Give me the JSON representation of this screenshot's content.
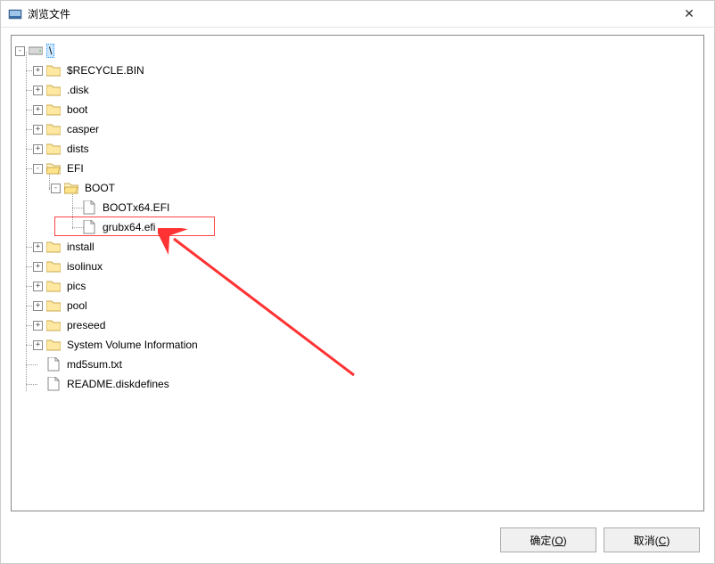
{
  "window": {
    "title": "浏览文件"
  },
  "tree": {
    "root": "\\",
    "items": [
      {
        "label": "$RECYCLE.BIN",
        "type": "folder",
        "expander": "+"
      },
      {
        "label": ".disk",
        "type": "folder",
        "expander": "+"
      },
      {
        "label": "boot",
        "type": "folder",
        "expander": "+"
      },
      {
        "label": "casper",
        "type": "folder",
        "expander": "+"
      },
      {
        "label": "dists",
        "type": "folder",
        "expander": "+"
      },
      {
        "label": "EFI",
        "type": "folder-open",
        "expander": "-"
      },
      {
        "label": "BOOT",
        "type": "folder-open",
        "expander": "-",
        "depth": 2
      },
      {
        "label": "BOOTx64.EFI",
        "type": "file",
        "depth": 3
      },
      {
        "label": "grubx64.efi",
        "type": "file",
        "depth": 3,
        "highlighted": true
      },
      {
        "label": "install",
        "type": "folder",
        "expander": "+"
      },
      {
        "label": "isolinux",
        "type": "folder",
        "expander": "+"
      },
      {
        "label": "pics",
        "type": "folder",
        "expander": "+"
      },
      {
        "label": "pool",
        "type": "folder",
        "expander": "+"
      },
      {
        "label": "preseed",
        "type": "folder",
        "expander": "+"
      },
      {
        "label": "System Volume Information",
        "type": "folder",
        "expander": "+"
      },
      {
        "label": "md5sum.txt",
        "type": "file"
      },
      {
        "label": "README.diskdefines",
        "type": "file"
      }
    ]
  },
  "buttons": {
    "ok": "确定(O)",
    "cancel": "取消(C)"
  }
}
